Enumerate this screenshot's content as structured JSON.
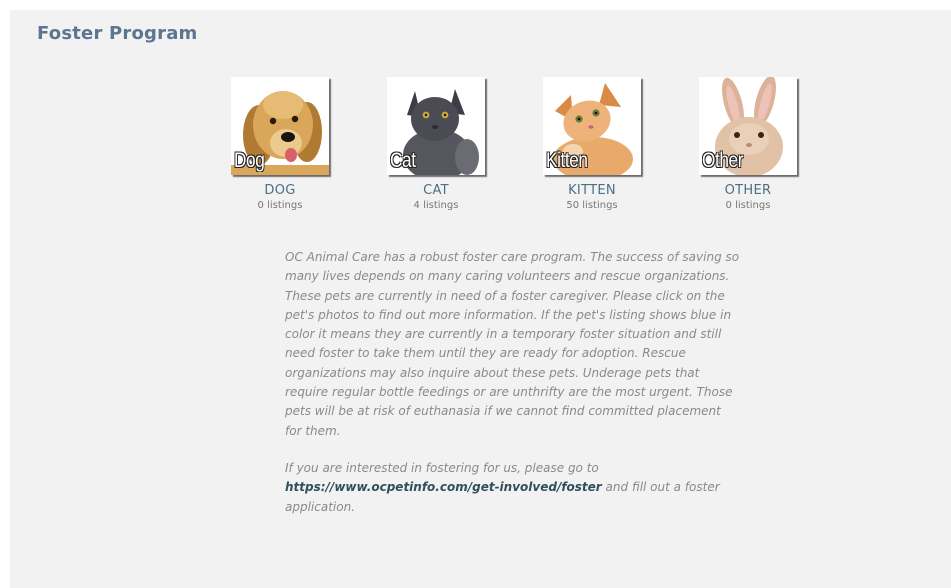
{
  "page": {
    "title": "Foster Program"
  },
  "categories": [
    {
      "thumb_label": "Dog",
      "name": "DOG",
      "count": "0 listings",
      "image": "golden-retriever-photo"
    },
    {
      "thumb_label": "Cat",
      "name": "CAT",
      "count": "4 listings",
      "image": "grey-cat-photo"
    },
    {
      "thumb_label": "Kitten",
      "name": "KITTEN",
      "count": "50 listings",
      "image": "orange-kitten-photo"
    },
    {
      "thumb_label": "Other",
      "name": "OTHER",
      "count": "0 listings",
      "image": "rabbit-photo"
    }
  ],
  "description": {
    "paragraph1": "OC Animal Care has a robust foster care program. The success of saving so many lives depends on many caring volunteers and rescue organizations. These pets are currently in need of a foster caregiver. Please click on the pet's photos to find out more information. If the pet's listing shows blue in color it means they are currently in a temporary foster situation and still need foster to take them until they are ready for adoption. Rescue organizations may also inquire about these pets. Underage pets that require regular bottle feedings or are unthrifty are the most urgent. Those pets will be at risk of euthanasia if we cannot find committed placement for them.",
    "paragraph2_before": "If you are interested in fostering for us, please go to ",
    "link_text": "https://www.ocpetinfo.com/get-involved/foster",
    "paragraph2_after": " and fill out a foster application."
  },
  "colors": {
    "panel_bg": "#f2f2f2",
    "title": "#5d7590",
    "category_name": "#4a6f86",
    "body_text": "#8a8a8a",
    "link": "#2f4f5a"
  }
}
